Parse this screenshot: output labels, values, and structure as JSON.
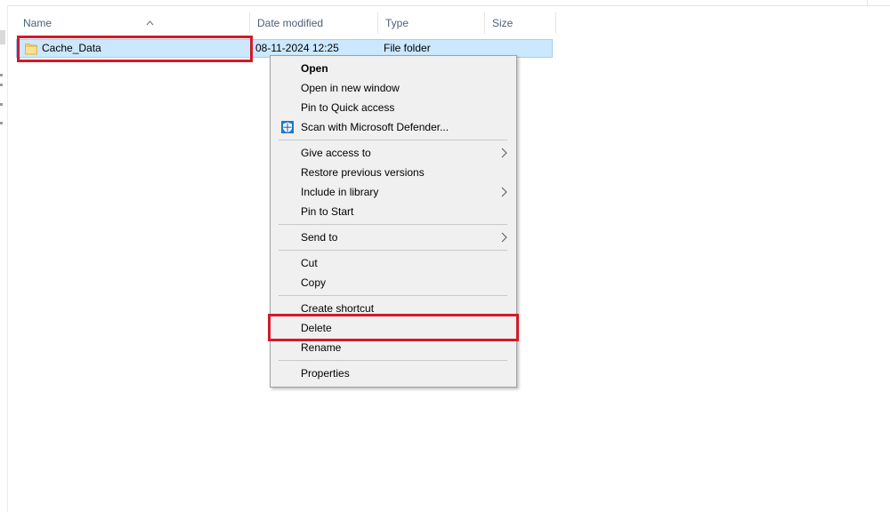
{
  "columns": {
    "name": "Name",
    "date_modified": "Date modified",
    "type": "Type",
    "size": "Size"
  },
  "file": {
    "name": "Cache_Data",
    "date_modified": "08-11-2024 12:25",
    "type": "File folder",
    "icon": "folder-icon"
  },
  "context_menu": {
    "open": "Open",
    "open_new_window": "Open in new window",
    "pin_quick_access": "Pin to Quick access",
    "scan_defender": "Scan with Microsoft Defender...",
    "give_access": "Give access to",
    "restore_versions": "Restore previous versions",
    "include_library": "Include in library",
    "pin_start": "Pin to Start",
    "send_to": "Send to",
    "cut": "Cut",
    "copy": "Copy",
    "create_shortcut": "Create shortcut",
    "delete": "Delete",
    "rename": "Rename",
    "properties": "Properties"
  },
  "colors": {
    "highlight_box": "#d11b2a",
    "selection_bg": "#cce8ff",
    "menu_bg": "#f0f0f0",
    "header_text": "#4c607a"
  }
}
